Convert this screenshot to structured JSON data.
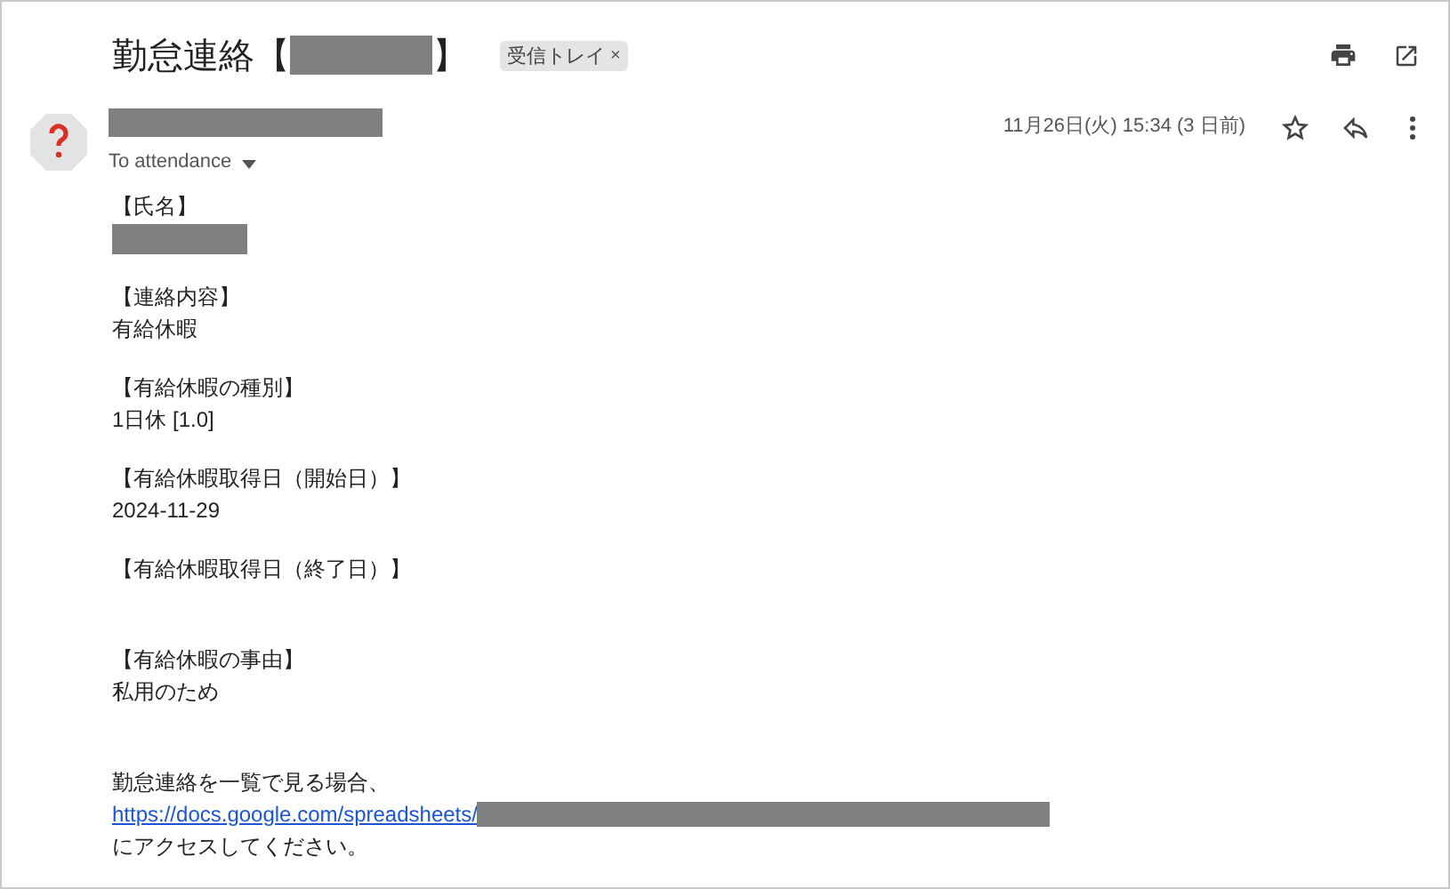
{
  "subject": {
    "title": "勤怠連絡【",
    "title_end": "】",
    "label": "受信トレイ",
    "label_close": "×"
  },
  "sender": {
    "to": "To attendance",
    "date": "11月26日(火) 15:34 (3 日前)"
  },
  "paragraphs": [
    {
      "lines": [
        {
          "kind": "text",
          "text": "【氏名】"
        },
        {
          "kind": "redacted"
        }
      ]
    },
    {
      "lines": [
        {
          "kind": "text",
          "text": "【連絡内容】"
        },
        {
          "kind": "text",
          "text": "有給休暇"
        }
      ]
    },
    {
      "lines": [
        {
          "kind": "text",
          "text": "【有給休暇の種別】"
        },
        {
          "kind": "text",
          "text": "1日休  [1.0]"
        }
      ]
    },
    {
      "lines": [
        {
          "kind": "text",
          "text": "【有給休暇取得日（開始日）】"
        },
        {
          "kind": "text",
          "text": "2024-11-29"
        }
      ]
    },
    {
      "lines": [
        {
          "kind": "text",
          "text": "【有給休暇取得日（終了日）】"
        },
        {
          "kind": "blank"
        }
      ]
    },
    {
      "lines": [
        {
          "kind": "text",
          "text": "【有給休暇の事由】"
        },
        {
          "kind": "text",
          "text": "私用のため"
        },
        {
          "kind": "blank"
        }
      ]
    },
    {
      "lines": [
        {
          "kind": "text",
          "text": "勤怠連絡を一覧で見る場合、"
        },
        {
          "kind": "link",
          "text": "https://docs.google.com/spreadsheets/"
        },
        {
          "kind": "text",
          "text": "にアクセスしてください。"
        }
      ]
    }
  ]
}
